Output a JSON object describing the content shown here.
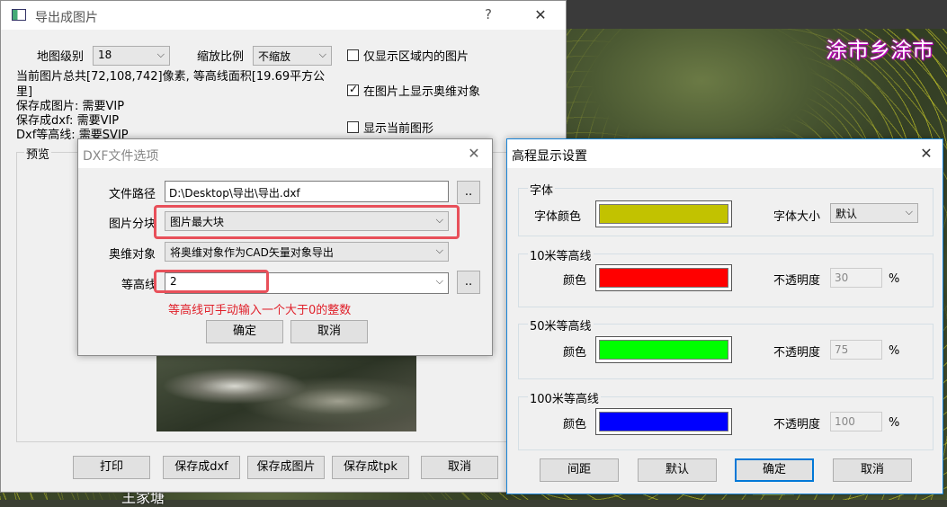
{
  "map": {
    "label_top_right": "涂市乡涂市",
    "label_bottom": "王家塘",
    "contour_color": "#e6e628"
  },
  "export_window": {
    "title": "导出成图片",
    "help": "?",
    "close": "✕",
    "map_level_label": "地图级别",
    "map_level_value": "18",
    "scale_label": "缩放比例",
    "scale_value": "不缩放",
    "only_region_label": "仅显示区域内的图片",
    "show_ovi_label": "在图片上显示奥维对象",
    "show_current_label": "显示当前图形",
    "info_line1": "当前图片总共[72,108,742]像素, 等高线面积[19.69平方公",
    "info_line2": "里]",
    "save_image_note": "保存成图片: 需要VIP",
    "save_dxf_note": "保存成dxf: 需要VIP",
    "dxf_contour_note": "Dxf等高线: 需要SVIP",
    "preview_label": "预览",
    "buttons": {
      "print": "打印",
      "save_dxf": "保存成dxf",
      "save_image": "保存成图片",
      "save_tpk": "保存成tpk",
      "cancel": "取消"
    }
  },
  "dxf_dialog": {
    "title": "DXF文件选项",
    "close": "✕",
    "path_label": "文件路径",
    "path_value": "D:\\Desktop\\导出\\导出.dxf",
    "browse": "..",
    "split_label": "图片分块",
    "split_value": "图片最大块",
    "ovi_label": "奥维对象",
    "ovi_value": "将奥维对象作为CAD矢量对象导出",
    "contour_label": "等高线",
    "contour_value": "2",
    "hint": "等高线可手动输入一个大于0的整数",
    "ok": "确定",
    "cancel": "取消",
    "hint_color": "#e0202a"
  },
  "elev_dialog": {
    "title": "高程显示设置",
    "close": "✕",
    "font_group": "字体",
    "font_color_label": "字体颜色",
    "font_color": "#c2c200",
    "font_size_label": "字体大小",
    "font_size_value": "默认",
    "g10_title": "10米等高线",
    "g10_color": "#ff0000",
    "g10_opacity": "30",
    "g50_title": "50米等高线",
    "g50_color": "#00ff00",
    "g50_opacity": "75",
    "g100_title": "100米等高线",
    "g100_color": "#0000ff",
    "g100_opacity": "100",
    "color_label": "颜色",
    "opacity_label": "不透明度",
    "percent": "%",
    "buttons": {
      "spacing": "间距",
      "default": "默认",
      "ok": "确定",
      "cancel": "取消"
    }
  }
}
